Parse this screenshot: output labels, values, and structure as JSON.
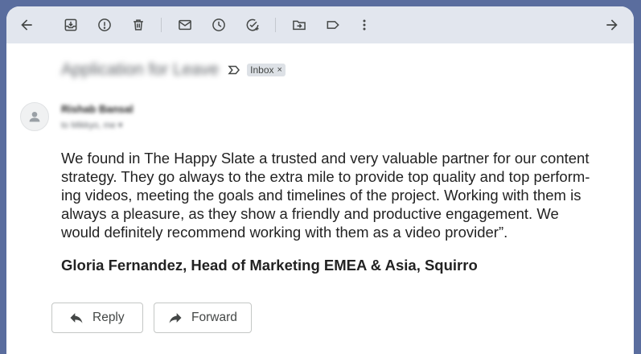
{
  "toolbar": {
    "icons": [
      "back-arrow-icon",
      "archive-icon",
      "report-spam-icon",
      "delete-icon",
      "mark-unread-icon",
      "snooze-icon",
      "add-to-tasks-icon",
      "move-to-icon",
      "label-icon",
      "more-vert-icon",
      "forward-arrow-icon"
    ]
  },
  "message": {
    "subject": "Application for Leave",
    "labels": [
      {
        "text": "Inbox",
        "remove": "×"
      }
    ],
    "sender_name": "Rishab Bansal",
    "recipient": "to Mikkyo, me",
    "recipient_chevron": "▾",
    "body_lines": [
      "We found in The Happy Slate a trusted and very valuable partner for our content",
      "strategy. They go always to the extra mile to provide top quality and top perform-",
      "ing videos, meeting the goals and timelines of the project. Working with them is",
      "always a pleasure, as they show a friendly and productive engagement. We",
      "would definitely recommend working with them as a video provider”."
    ],
    "signature": "Gloria Fernandez, Head of Marketing EMEA & Asia, Squirro"
  },
  "actions": {
    "reply_label": "Reply",
    "forward_label": "Forward"
  },
  "colors": {
    "toolbar_bg": "#e2e6ee",
    "page_bg": "#5a6d9e",
    "icon": "#444746"
  }
}
